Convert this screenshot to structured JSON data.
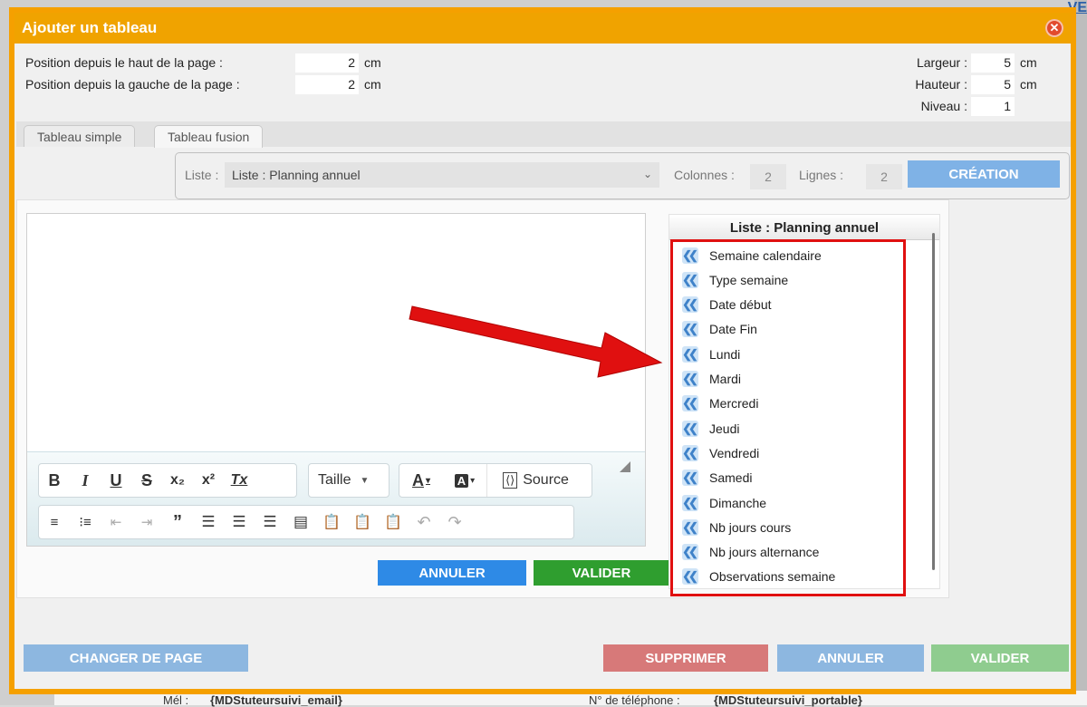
{
  "background": {
    "top_right_text": "VE",
    "bottom_email_label": "Mél :",
    "bottom_email_value": "{MDStuteursuivi_email}",
    "bottom_phone_label": "N° de téléphone :",
    "bottom_phone_value": "{MDStuteursuivi_portable}"
  },
  "dialog": {
    "title": "Ajouter un tableau",
    "close_glyph": "✕"
  },
  "position": {
    "top_label": "Position depuis le haut de la page :",
    "top_value": "2",
    "left_label": "Position depuis la gauche de la page :",
    "left_value": "2",
    "unit": "cm"
  },
  "dimensions": {
    "largeur_label": "Largeur :",
    "largeur_value": "5",
    "hauteur_label": "Hauteur :",
    "hauteur_value": "5",
    "niveau_label": "Niveau :",
    "niveau_value": "1",
    "unit": "cm"
  },
  "tabs": [
    {
      "label": "Tableau simple",
      "active": false
    },
    {
      "label": "Tableau fusion",
      "active": true
    }
  ],
  "fusion": {
    "liste_label": "Liste :",
    "liste_selected": "Liste : Planning annuel",
    "colonnes_label": "Colonnes :",
    "colonnes_value": "2",
    "lignes_label": "Lignes :",
    "lignes_value": "2",
    "creation_label": "CRÉATION"
  },
  "toolbar": {
    "bold": "B",
    "italic": "I",
    "underline": "U",
    "strike": "S",
    "subscript": "x₂",
    "superscript": "x²",
    "clear_format": "Tx",
    "size_label": "Taille",
    "source_label": "Source"
  },
  "editor_buttons": {
    "annuler": "ANNULER",
    "valider": "VALIDER"
  },
  "field_list": {
    "header": "Liste : Planning annuel",
    "items": [
      "Semaine calendaire",
      "Type semaine",
      "Date début",
      "Date Fin",
      "Lundi",
      "Mardi",
      "Mercredi",
      "Jeudi",
      "Vendredi",
      "Samedi",
      "Dimanche",
      "Nb jours cours",
      "Nb jours alternance",
      "Observations semaine"
    ]
  },
  "bottom_buttons": {
    "changer_page": "CHANGER DE PAGE",
    "supprimer": "SUPPRIMER",
    "annuler": "ANNULER",
    "valider": "VALIDER"
  },
  "colors": {
    "dialog_border": "#f5a000",
    "highlight_box": "#e01010",
    "arrow": "#e01010",
    "primary_blue": "#2e8ae6",
    "primary_green": "#2f9e2f"
  }
}
